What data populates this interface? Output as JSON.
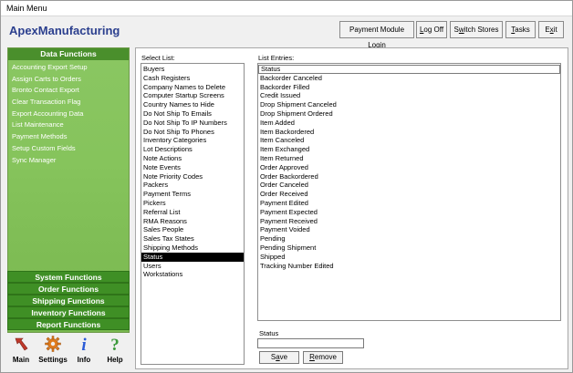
{
  "window": {
    "title": "Main Menu"
  },
  "app": {
    "name": "ApexManufacturing"
  },
  "toolbar": {
    "payment_login": {
      "pre": "Payment Module Login",
      "key": "",
      "post": ""
    },
    "logoff": {
      "pre": "",
      "key": "L",
      "post": "og Off"
    },
    "switch": {
      "pre": "S",
      "key": "w",
      "post": "itch Stores"
    },
    "tasks": {
      "pre": "",
      "key": "T",
      "post": "asks"
    },
    "exit": {
      "pre": "E",
      "key": "x",
      "post": "it"
    }
  },
  "sidebar": {
    "header": "Data Functions",
    "items": [
      "Accounting Export Setup",
      "Assign Carts to Orders",
      "Bronto Contact Export",
      "Clear Transaction Flag",
      "Export Accounting Data",
      "List Maintenance",
      "Payment Methods",
      "Setup Custom Fields",
      "Sync Manager"
    ],
    "function_bars": [
      "System Functions",
      "Order Functions",
      "Shipping Functions",
      "Inventory Functions",
      "Report Functions"
    ]
  },
  "bottom_icons": [
    {
      "label": "Main",
      "icon": "main-arrow-icon"
    },
    {
      "label": "Settings",
      "icon": "gear-icon"
    },
    {
      "label": "Info",
      "icon": "info-icon"
    },
    {
      "label": "Help",
      "icon": "help-icon"
    }
  ],
  "select_list": {
    "label": "Select List:",
    "items": [
      "Buyers",
      "Cash Registers",
      "Company Names to Delete",
      "Computer Startup Screens",
      "Country Names to Hide",
      "Do Not Ship To Emails",
      "Do Not Ship To IP Numbers",
      "Do Not Ship To Phones",
      "Inventory Categories",
      "Lot Descriptions",
      "Note Actions",
      "Note Events",
      "Note Priority Codes",
      "Packers",
      "Payment Terms",
      "Pickers",
      "Referral List",
      "RMA Reasons",
      "Sales People",
      "Sales Tax States",
      "Shipping Methods",
      "Status",
      "Users",
      "Workstations"
    ],
    "selected": "Status"
  },
  "list_entries": {
    "label": "List Entries:",
    "items": [
      "Status",
      "Backorder Canceled",
      "Backorder Filled",
      "Credit Issued",
      "Drop Shipment Canceled",
      "Drop Shipment Ordered",
      "Item Added",
      "Item Backordered",
      "Item Canceled",
      "Item Exchanged",
      "Item Returned",
      "Order Approved",
      "Order Backordered",
      "Order Canceled",
      "Order Received",
      "Payment Edited",
      "Payment Expected",
      "Payment Received",
      "Payment Voided",
      "Pending",
      "Pending Shipment",
      "Shipped",
      "Tracking Number Edited"
    ],
    "highlighted": "Status"
  },
  "status_field": {
    "label": "Status",
    "value": ""
  },
  "buttons": {
    "save": {
      "pre": "S",
      "key": "a",
      "post": "ve"
    },
    "remove": {
      "pre": "",
      "key": "R",
      "post": "emove"
    }
  }
}
